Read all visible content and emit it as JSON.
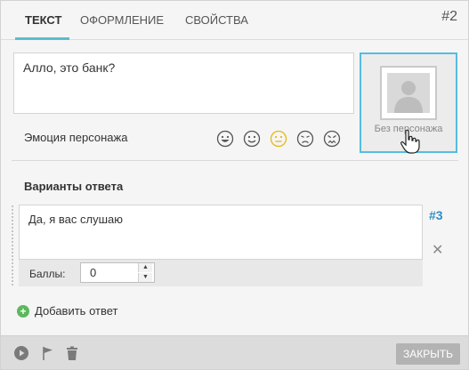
{
  "tabs": [
    {
      "label": "Текст",
      "active": true
    },
    {
      "label": "Оформление",
      "active": false
    },
    {
      "label": "Свойства",
      "active": false
    }
  ],
  "node_id": "#2",
  "replica_text": "Алло, это банк?",
  "portrait": {
    "label": "Без персонажа"
  },
  "emotion": {
    "label": "Эмоция персонажа",
    "icons": [
      "very-happy-icon",
      "happy-icon",
      "neutral-icon",
      "sad-icon",
      "angry-icon"
    ],
    "selected": "neutral-icon",
    "selected_color": "#e5b912",
    "default_color": "#555555"
  },
  "variants": {
    "label": "Варианты ответа",
    "answers": [
      {
        "text": "Да, я вас слушаю",
        "id": "#3",
        "score_label": "Баллы:",
        "score": "0"
      }
    ],
    "add_label": "Добавить ответ"
  },
  "footer": {
    "close_label": "Закрыть"
  },
  "colors": {
    "accent": "#5cbcd0",
    "link": "#2b8fc6",
    "add": "#5cb85c"
  }
}
